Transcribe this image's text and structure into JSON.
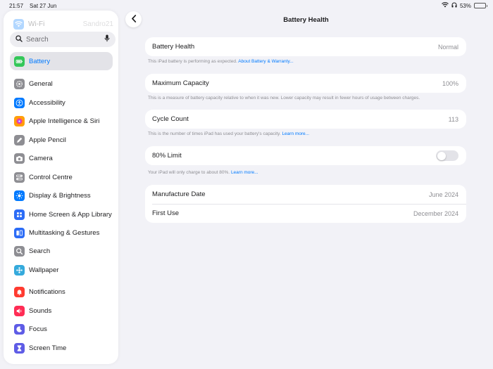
{
  "status_bar": {
    "time": "21:57",
    "date": "Sat 27 Jun",
    "battery_percent": "53%",
    "battery_level": 0.53
  },
  "sidebar": {
    "wifi": {
      "label": "Wi-Fi",
      "value": "Sandro21"
    },
    "search_placeholder": "Search",
    "items": [
      {
        "label": "Battery",
        "selected": true,
        "color": "#34c759",
        "icon": "battery-icon"
      },
      {
        "label": "General",
        "color": "#8e8e93",
        "icon": "gear-icon"
      },
      {
        "label": "Accessibility",
        "color": "#007aff",
        "icon": "accessibility-icon"
      },
      {
        "label": "Apple Intelligence & Siri",
        "color": "#ff9f0a",
        "icon": "siri-icon"
      },
      {
        "label": "Apple Pencil",
        "color": "#8e8e93",
        "icon": "pencil-icon"
      },
      {
        "label": "Camera",
        "color": "#8e8e93",
        "icon": "camera-icon"
      },
      {
        "label": "Control Centre",
        "color": "#8e8e93",
        "icon": "control-centre-icon"
      },
      {
        "label": "Display & Brightness",
        "color": "#007aff",
        "icon": "sun-icon"
      },
      {
        "label": "Home Screen & App Library",
        "color": "#2c6cf6",
        "icon": "home-screen-icon"
      },
      {
        "label": "Multitasking & Gestures",
        "color": "#2c6cf6",
        "icon": "multitasking-icon"
      },
      {
        "label": "Search",
        "color": "#8e8e93",
        "icon": "search-icon"
      },
      {
        "label": "Wallpaper",
        "color": "#35aadc",
        "icon": "wallpaper-icon"
      },
      {
        "label": "Notifications",
        "color": "#ff3b30",
        "icon": "bell-icon"
      },
      {
        "label": "Sounds",
        "color": "#ff2d55",
        "icon": "speaker-icon"
      },
      {
        "label": "Focus",
        "color": "#5e5ce6",
        "icon": "moon-icon"
      },
      {
        "label": "Screen Time",
        "color": "#5e5ce6",
        "icon": "hourglass-icon"
      }
    ]
  },
  "main": {
    "title": "Battery Health",
    "battery_health": {
      "label": "Battery Health",
      "value": "Normal"
    },
    "battery_health_note": {
      "text": "This iPad battery is performing as expected.",
      "link": "About Battery & Warranty..."
    },
    "maximum_capacity": {
      "label": "Maximum Capacity",
      "value": "100%"
    },
    "maximum_capacity_note": "This is a measure of battery capacity relative to when it was new. Lower capacity may result in fewer hours of usage between charges.",
    "cycle_count": {
      "label": "Cycle Count",
      "value": "113"
    },
    "cycle_count_note": {
      "text": "This is the number of times iPad has used your battery's capacity.",
      "link": "Learn more..."
    },
    "limit_80": {
      "label": "80% Limit",
      "enabled": false
    },
    "limit_80_note": {
      "text": "Your iPad will only charge to about 80%.",
      "link": "Learn more..."
    },
    "manufacture_date": {
      "label": "Manufacture Date",
      "value": "June 2024"
    },
    "first_use": {
      "label": "First Use",
      "value": "December 2024"
    }
  },
  "colors": {
    "accent": "#007aff",
    "background": "#f2f2f7",
    "selected_row": "#e3e3e8"
  }
}
